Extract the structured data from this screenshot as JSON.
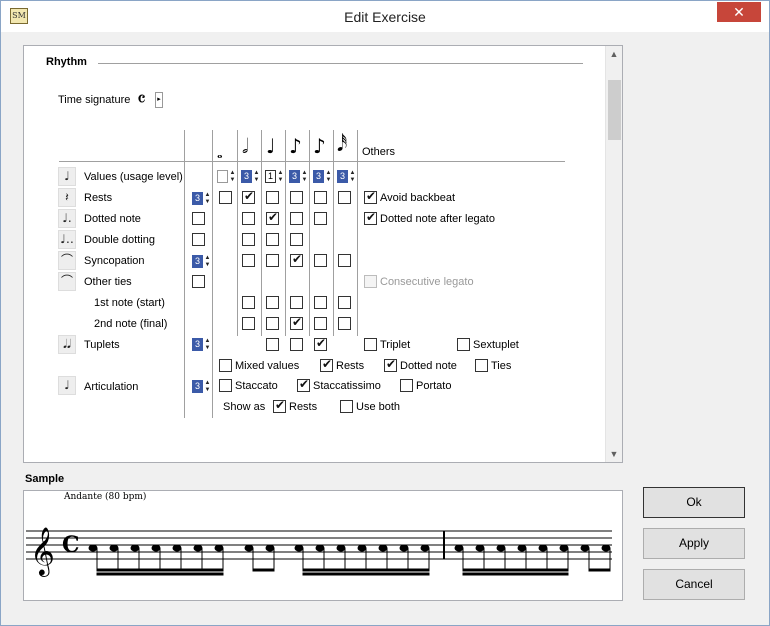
{
  "window": {
    "title": "Edit Exercise",
    "app_icon": "SM",
    "close_glyph": "✕"
  },
  "rhythm": {
    "section_title": "Rhythm",
    "time_signature_label": "Time signature",
    "time_signature_symbol": "𝄴",
    "others_header": "Others",
    "note_symbols": [
      "𝅝",
      "𝅗𝅥",
      "♩",
      "♪",
      "♪",
      "𝅘𝅥𝅰"
    ],
    "rows": [
      {
        "label": "Values (usage level)",
        "icon": "quarter-note-icon"
      },
      {
        "label": "Rests",
        "icon": "quarter-rest-icon"
      },
      {
        "label": "Dotted note",
        "icon": "dotted-note-icon"
      },
      {
        "label": "Double dotting",
        "icon": "double-dotted-note-icon"
      },
      {
        "label": "Syncopation",
        "icon": "syncopation-icon"
      },
      {
        "label": "Other ties",
        "icon": "tie-icon"
      },
      {
        "label": "1st note (start)",
        "icon": ""
      },
      {
        "label": "2nd note (final)",
        "icon": ""
      },
      {
        "label": "Tuplets",
        "icon": "tuplet-icon"
      },
      {
        "label": "Articulation",
        "icon": "articulation-icon"
      }
    ],
    "usage_levels": [
      "",
      "3",
      "1",
      "3",
      "3",
      "3"
    ],
    "row_spin_values": {
      "rests": "3",
      "syncopation": "3",
      "tuplets": "3",
      "articulation": "3"
    },
    "others": {
      "avoid_backbeat": "Avoid backbeat",
      "dotted_after_legato": "Dotted note after legato",
      "consecutive_legato": "Consecutive legato",
      "triplet": "Triplet",
      "sextuplet": "Sextuplet",
      "mixed_values": "Mixed values",
      "rests": "Rests",
      "dotted_note": "Dotted note",
      "ties": "Ties",
      "staccato": "Staccato",
      "staccatissimo": "Staccatissimo",
      "portato": "Portato",
      "show_as": "Show as",
      "show_rests": "Rests",
      "use_both": "Use both"
    }
  },
  "sample": {
    "title": "Sample",
    "tempo": "Andante (80 bpm)"
  },
  "buttons": {
    "ok": "Ok",
    "apply": "Apply",
    "cancel": "Cancel"
  }
}
